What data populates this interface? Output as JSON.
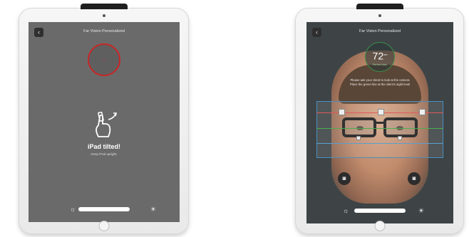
{
  "left_screen": {
    "title": "Far Vision Personalized",
    "back_icon": "chevron-left-icon",
    "alert_title": "iPad tilted!",
    "alert_subtitle": "Keep iPad upright.",
    "gauge_color": "#c62828"
  },
  "right_screen": {
    "title": "Far Vision Personalized",
    "back_icon": "chevron-left-icon",
    "gauge_value": "72",
    "gauge_unit": "cm",
    "gauge_caption": "Perfect dist.",
    "gauge_color": "#3a8f4a",
    "instruction_1": "Please ask your client to look at the camera",
    "instruction_2": "Place the green line at the client's sight level",
    "camera_button_icon": "camera-icon"
  },
  "brightness": {
    "low_icon": "sun-low-icon",
    "high_icon": "sun-high-icon"
  }
}
